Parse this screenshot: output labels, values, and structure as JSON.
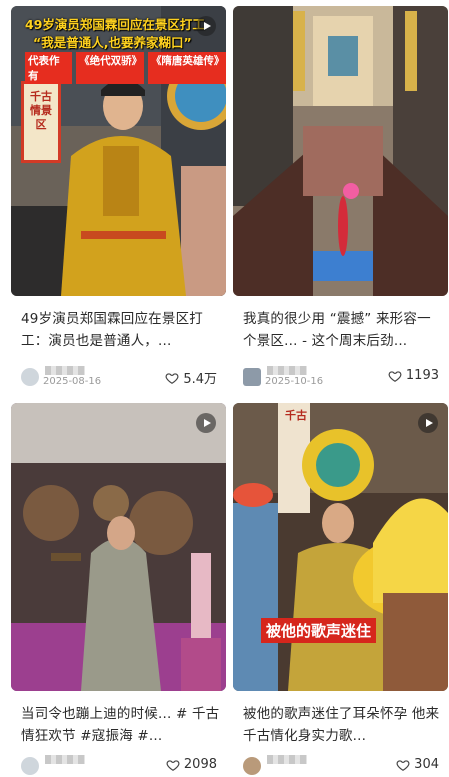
{
  "feed": [
    {
      "overlay": {
        "headline_1": "49岁演员郑国霖回应在景区打工",
        "headline_2": "“我是普通人,也要养家糊口”",
        "tag_1": "代表作有",
        "tag_2": "《绝代双骄》",
        "tag_3": "《隋唐英雄传》",
        "sign": "千古情景区"
      },
      "title": "49岁演员郑国霖回应在景区打工：演员也是普通人，...",
      "date": "2025-08-16",
      "likes": "5.4万"
    },
    {
      "title": "我真的很少用 “震撼” 来形容一个景区... - 这个周末后劲...",
      "date": "2025-10-16",
      "likes": "1193"
    },
    {
      "title": "当司令也蹦上迪的时候... # 千古情狂欢节 #寇振海 #...",
      "date": "",
      "likes": "2098"
    },
    {
      "overlay": {
        "caption": "被他的歌声迷住",
        "sign": "千古"
      },
      "title": "被他的歌声迷住了耳朵怀孕 他来千古情化身实力歌...",
      "date": "",
      "likes": "304"
    }
  ],
  "colors": {
    "overlay_yellow": "#ffd21f",
    "overlay_red": "#e62d1f",
    "caption_red": "#d6261c",
    "heart_stroke": "#444444"
  }
}
